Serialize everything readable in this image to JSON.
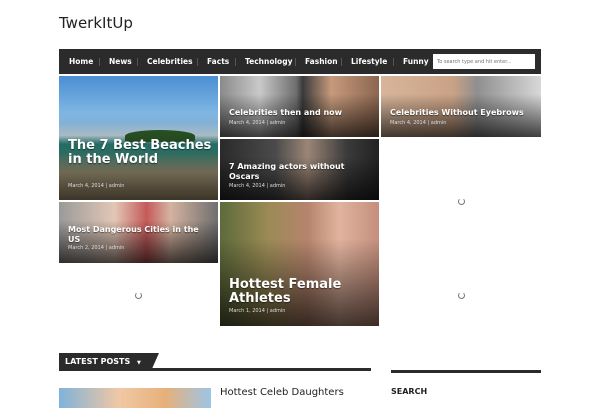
{
  "site": {
    "title": "TwerkItUp"
  },
  "nav": {
    "items": [
      {
        "label": "Home"
      },
      {
        "label": "News"
      },
      {
        "label": "Celebrities"
      },
      {
        "label": "Facts"
      },
      {
        "label": "Technology"
      },
      {
        "label": "Fashion"
      },
      {
        "label": "Lifestyle"
      },
      {
        "label": "Funny"
      }
    ],
    "search_placeholder": "To search type and hit enter..."
  },
  "tiles": [
    {
      "title": "The 7 Best Beaches in the World",
      "meta": "March 4, 2014 | admin"
    },
    {
      "title": "Celebrities then and now",
      "meta": "March 4, 2014 | admin"
    },
    {
      "title": "Celebrities Without Eyebrows",
      "meta": "March 4, 2014 | admin"
    },
    {
      "title": "7 Amazing actors without Oscars",
      "meta": "March 4, 2014 | admin"
    },
    {
      "title": "Most Dangerous Cities in the US",
      "meta": "March 2, 2014 | admin"
    },
    {
      "title": "Hottest Female Athletes",
      "meta": "March 1, 2014 | admin"
    }
  ],
  "latest": {
    "heading": "LATEST POSTS",
    "arrow": "▼",
    "first_post_title": "Hottest Celeb Daughters"
  },
  "sidebar": {
    "search_heading": "SEARCH"
  },
  "colors": {
    "nav_bg": "#2b2b2b",
    "accent": "#2b2b2b"
  }
}
